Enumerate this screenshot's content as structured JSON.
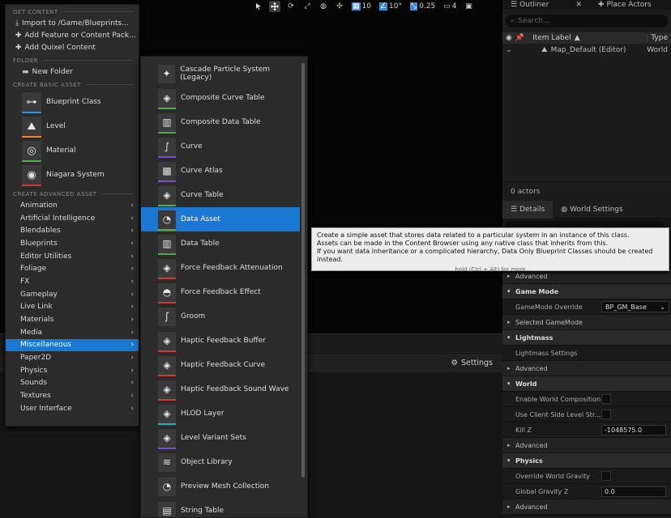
{
  "toolbar": {
    "grid_value": "10",
    "angle_value": "10°",
    "scale_value": "0.25",
    "camera_speed": "4"
  },
  "viewport_bottom": {
    "settings_label": "Settings"
  },
  "outliner": {
    "tab_label": "Outliner",
    "place_actors_label": "Place Actors",
    "search_placeholder": "Search...",
    "col_item_label": "Item Label",
    "col_type": "Type",
    "row_label": "Map_Default (Editor)",
    "row_type": "World",
    "actor_count": "0 actors"
  },
  "details": {
    "tab_details": "Details",
    "tab_world_settings": "World Settings",
    "sections": [
      {
        "kind": "sec",
        "label": "Advanced"
      },
      {
        "kind": "head",
        "label": "Game Mode"
      },
      {
        "kind": "prop",
        "label": "GameMode Override",
        "ctrl": "dd",
        "value": "BP_GM_Base"
      },
      {
        "kind": "sec",
        "label": "Selected GameMode"
      },
      {
        "kind": "head",
        "label": "Lightmass"
      },
      {
        "kind": "prop",
        "label": "Lightmass Settings",
        "ctrl": "none",
        "value": ""
      },
      {
        "kind": "sec",
        "label": "Advanced"
      },
      {
        "kind": "head",
        "label": "World"
      },
      {
        "kind": "prop",
        "label": "Enable World Composition",
        "ctrl": "chk",
        "value": ""
      },
      {
        "kind": "prop",
        "label": "Use Client Side Level Str...",
        "ctrl": "chk",
        "value": ""
      },
      {
        "kind": "prop",
        "label": "Kill Z",
        "ctrl": "inp",
        "value": "-1048575.0"
      },
      {
        "kind": "sec",
        "label": "Advanced"
      },
      {
        "kind": "head",
        "label": "Physics"
      },
      {
        "kind": "prop",
        "label": "Override World Gravity",
        "ctrl": "chk",
        "value": ""
      },
      {
        "kind": "prop",
        "label": "Global Gravity Z",
        "ctrl": "inp",
        "value": "0.0"
      },
      {
        "kind": "sec",
        "label": "Advanced"
      }
    ]
  },
  "main_menu": {
    "get_content_header": "GET CONTENT",
    "get_content": [
      "Import to /Game/Blueprints...",
      "Add Feature or Content Pack...",
      "Add Quixel Content"
    ],
    "folder_header": "FOLDER",
    "new_folder": "New Folder",
    "basic_header": "CREATE BASIC ASSET",
    "basic_assets": [
      {
        "label": "Blueprint Class",
        "icon": "blueprint-class-icon",
        "color": "#3a8bd6"
      },
      {
        "label": "Level",
        "icon": "level-icon",
        "color": "#e08a2a"
      },
      {
        "label": "Material",
        "icon": "material-icon",
        "color": "#4cae4c"
      },
      {
        "label": "Niagara System",
        "icon": "niagara-system-icon",
        "color": "#d23a3a"
      }
    ],
    "advanced_header": "CREATE ADVANCED ASSET",
    "categories": [
      "Animation",
      "Artificial Intelligence",
      "Blendables",
      "Blueprints",
      "Editor Utilities",
      "Foliage",
      "FX",
      "Gameplay",
      "Live Link",
      "Materials",
      "Media",
      "Miscellaneous",
      "Paper2D",
      "Physics",
      "Sounds",
      "Textures",
      "User Interface"
    ],
    "selected_category": "Miscellaneous"
  },
  "sub_menu": {
    "items": [
      {
        "label": "Cascade Particle System (Legacy)",
        "icon": "particle-system-icon",
        "color": "#2b2b2b"
      },
      {
        "label": "Composite Curve Table",
        "icon": "curve-table-icon",
        "color": "#4cae4c"
      },
      {
        "label": "Composite Data Table",
        "icon": "data-table-icon",
        "color": "#4cae4c"
      },
      {
        "label": "Curve",
        "icon": "curve-icon",
        "color": "#7a4fc9"
      },
      {
        "label": "Curve Atlas",
        "icon": "curve-atlas-icon",
        "color": "#7a4fc9"
      },
      {
        "label": "Curve Table",
        "icon": "curve-table-icon",
        "color": "#4cae4c"
      },
      {
        "label": "Data Asset",
        "icon": "data-asset-icon",
        "color": "#4cae4c"
      },
      {
        "label": "Data Table",
        "icon": "data-table-icon",
        "color": "#4cae4c"
      },
      {
        "label": "Force Feedback Attenuation",
        "icon": "force-feedback-attenuation-icon",
        "color": "#d23a3a"
      },
      {
        "label": "Force Feedback Effect",
        "icon": "force-feedback-effect-icon",
        "color": "#d23a3a"
      },
      {
        "label": "Groom",
        "icon": "groom-icon",
        "color": "#2b2b2b"
      },
      {
        "label": "Haptic Feedback Buffer",
        "icon": "haptic-feedback-icon",
        "color": "#d23a3a"
      },
      {
        "label": "Haptic Feedback Curve",
        "icon": "haptic-feedback-icon",
        "color": "#d23a3a"
      },
      {
        "label": "Haptic Feedback Sound Wave",
        "icon": "haptic-feedback-icon",
        "color": "#d23a3a"
      },
      {
        "label": "HLOD Layer",
        "icon": "hlod-layer-icon",
        "color": "#21b3b3"
      },
      {
        "label": "Level Variant Sets",
        "icon": "level-variant-sets-icon",
        "color": "#7a4fc9"
      },
      {
        "label": "Object Library",
        "icon": "object-library-icon",
        "color": "#2b2b2b"
      },
      {
        "label": "Preview Mesh Collection",
        "icon": "preview-mesh-icon",
        "color": "#2b2b2b"
      },
      {
        "label": "String Table",
        "icon": "string-table-icon",
        "color": "#2b2b2b"
      }
    ],
    "selected": "Data Asset"
  },
  "tooltip": {
    "line1": "Create a simple asset that stores data related to a particular system in an instance of this class.",
    "line2": "Assets can be made in the Content Browser using any native class that inherits from this.",
    "line3": "If you want data inheritance or a complicated hierarchy, Data Only Blueprint Classes should be created instead.",
    "hint": "hold (Ctrl + Alt) for more"
  }
}
